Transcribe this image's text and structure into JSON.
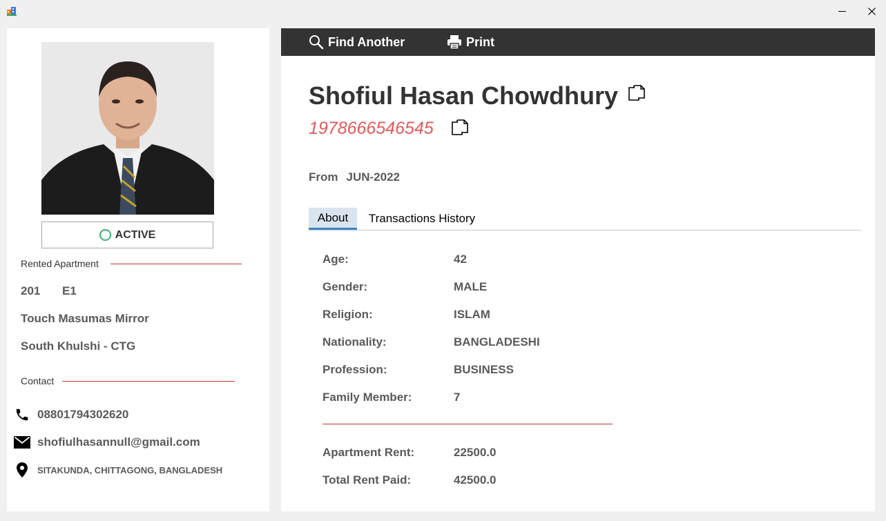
{
  "window": {
    "minimize_glyph": "—",
    "close_glyph": "✕"
  },
  "left": {
    "status": "ACTIVE",
    "rented_apartment_label": "Rented Apartment",
    "apartment_no": "201",
    "block": "E1",
    "building": "Touch Masumas Mirror",
    "area": "South Khulshi - CTG",
    "contact_label": "Contact",
    "phone": "08801794302620",
    "email": "shofiulhasannull@gmail.com",
    "address": "SITAKUNDA, CHITTAGONG, BANGLADESH",
    "icons": {
      "phone": "phone-icon",
      "email": "envelope-icon",
      "address": "location-pin-icon"
    }
  },
  "toolbar": {
    "find_label": "Find Another",
    "print_label": "Print",
    "icons": {
      "find": "search-icon",
      "print": "printer-icon"
    }
  },
  "profile": {
    "name": "Shofiul Hasan Chowdhury",
    "id_number": "1978666546545",
    "from_label": "From",
    "from_value": "JUN-2022"
  },
  "tabs": [
    {
      "label": "About",
      "active": true
    },
    {
      "label": "Transactions History",
      "active": false
    }
  ],
  "about": {
    "fields": [
      {
        "label": "Age:",
        "value": "42"
      },
      {
        "label": "Gender:",
        "value": "MALE"
      },
      {
        "label": "Religion:",
        "value": "ISLAM"
      },
      {
        "label": "Nationality:",
        "value": "BANGLADESHI"
      },
      {
        "label": "Profession:",
        "value": "BUSINESS"
      },
      {
        "label": "Family Member:",
        "value": "7"
      }
    ],
    "rent_fields": [
      {
        "label": "Apartment Rent:",
        "value": "22500.0"
      },
      {
        "label": "Total Rent Paid:",
        "value": "42500.0"
      }
    ]
  },
  "colors": {
    "toolbar_bg": "#333333",
    "id_number": "#e25a5a",
    "section_line": "#c0392b",
    "active_ring": "#3cb371",
    "tab_active_bg": "#d9e4ee",
    "tab_active_border": "#3a84c4"
  }
}
